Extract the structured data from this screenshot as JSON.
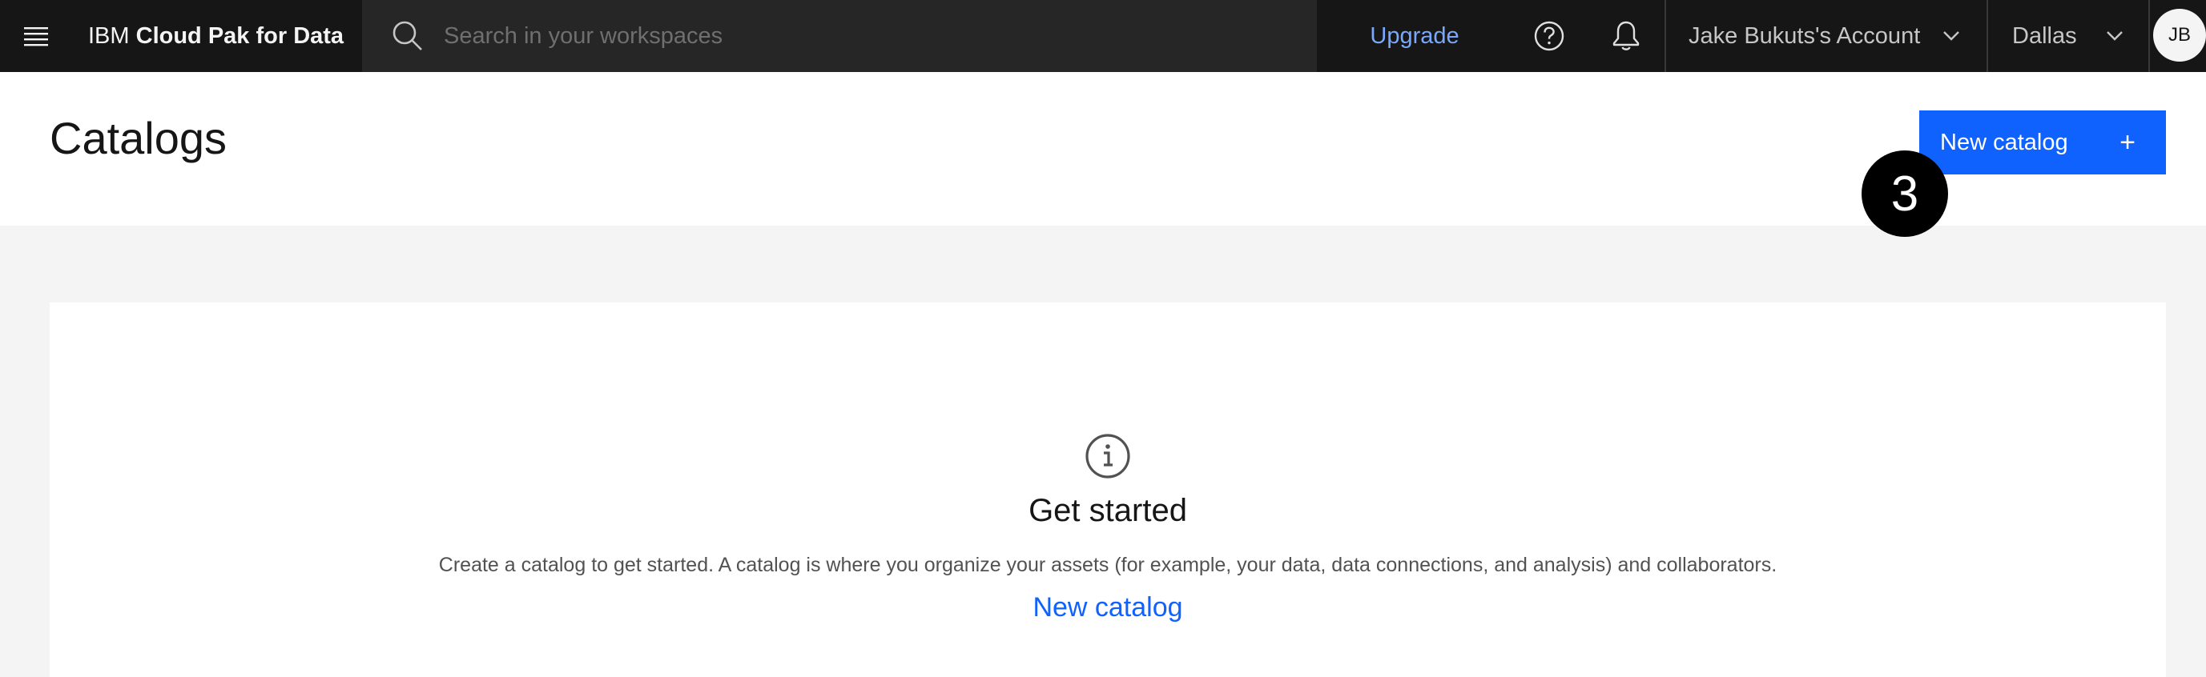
{
  "header": {
    "brand_prefix": "IBM ",
    "brand_name": "Cloud Pak for Data",
    "search_placeholder": "Search in your workspaces",
    "search_value": "",
    "upgrade_label": "Upgrade",
    "account_label": "Jake Bukuts's Account",
    "region_label": "Dallas",
    "avatar_initials": "JB",
    "icons": [
      "menu-icon",
      "search-icon",
      "help-icon",
      "notification-icon",
      "chevron-down-icon"
    ]
  },
  "page": {
    "title": "Catalogs",
    "primary_button_label": "New catalog",
    "primary_button_icon": "+",
    "step_badge": "3"
  },
  "empty_state": {
    "icon": "info-icon",
    "heading": "Get started",
    "description": "Create a catalog to get started. A catalog is where you organize your assets (for example, your data, data connections, and analysis) and collaborators.",
    "link_label": "New catalog"
  },
  "colors": {
    "header_bg": "#161616",
    "search_bg": "#262626",
    "accent": "#0f62fe",
    "link_on_dark": "#78a9ff",
    "page_bg": "#f4f4f4"
  }
}
